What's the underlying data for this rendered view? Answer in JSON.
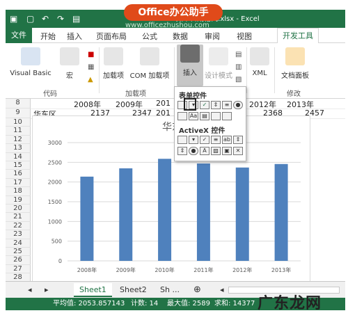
{
  "title_bar": {
    "window_title": "项目 日期格式.xlsx - Excel",
    "watermark": "Office办公助手",
    "watermark_url": "www.officezhushou.com"
  },
  "tabs": [
    {
      "label": "文件"
    },
    {
      "label": "开始"
    },
    {
      "label": "插入"
    },
    {
      "label": "页面布局"
    },
    {
      "label": "公式"
    },
    {
      "label": "数据"
    },
    {
      "label": "审阅"
    },
    {
      "label": "视图"
    },
    {
      "label": "开发工具"
    }
  ],
  "ribbon": {
    "visual_basic": "Visual Basic",
    "macro": "宏",
    "addins": "加载项",
    "com_addins": "COM 加载项",
    "insert": "插入",
    "design_mode": "设计模式",
    "xml": "XML",
    "doc_panel": "文档面板",
    "groups": {
      "code": "代码",
      "addins": "加载项",
      "modify": "修改"
    }
  },
  "sheet": {
    "row8": {
      "num": "8",
      "c1": "2008年",
      "c2": "2009年",
      "c3": "201",
      "c4": "2012年",
      "c5": "2013年"
    },
    "row9": {
      "num": "9",
      "label": "华东区",
      "v1": "2137",
      "v2": "2347",
      "v3": "201",
      "v5": "2368",
      "v6": "2457"
    },
    "rows": [
      "10",
      "11",
      "12",
      "13",
      "14",
      "15",
      "16",
      "17",
      "18",
      "19",
      "20",
      "21",
      "22",
      "23",
      "24",
      "25",
      "26",
      "27",
      "28"
    ]
  },
  "dropdown": {
    "form_controls": "表单控件",
    "activex_controls": "ActiveX 控件"
  },
  "chart_data": {
    "type": "bar",
    "title": "华东",
    "categories": [
      "2008年",
      "2009年",
      "2010年",
      "2011年",
      "2012年",
      "2013年"
    ],
    "values": [
      2137,
      2347,
      2589,
      2470,
      2368,
      2457
    ],
    "ylim": [
      0,
      3000
    ],
    "yticks": [
      "0",
      "500",
      "1000",
      "1500",
      "2000",
      "2500",
      "3000"
    ],
    "grid": true,
    "bar_color": "#4f81bd"
  },
  "sheet_tabs": [
    "Sheet1",
    "Sheet2",
    "Sh ..."
  ],
  "status": {
    "avg": "平均值: 2053.857143",
    "count": "计数: 14",
    "max": "最大值: 2589",
    "sum": "求和: 14377"
  },
  "corner_watermark": "广东龙网",
  "colors": {
    "excel_green": "#217346",
    "watermark": "#e04a1a"
  }
}
